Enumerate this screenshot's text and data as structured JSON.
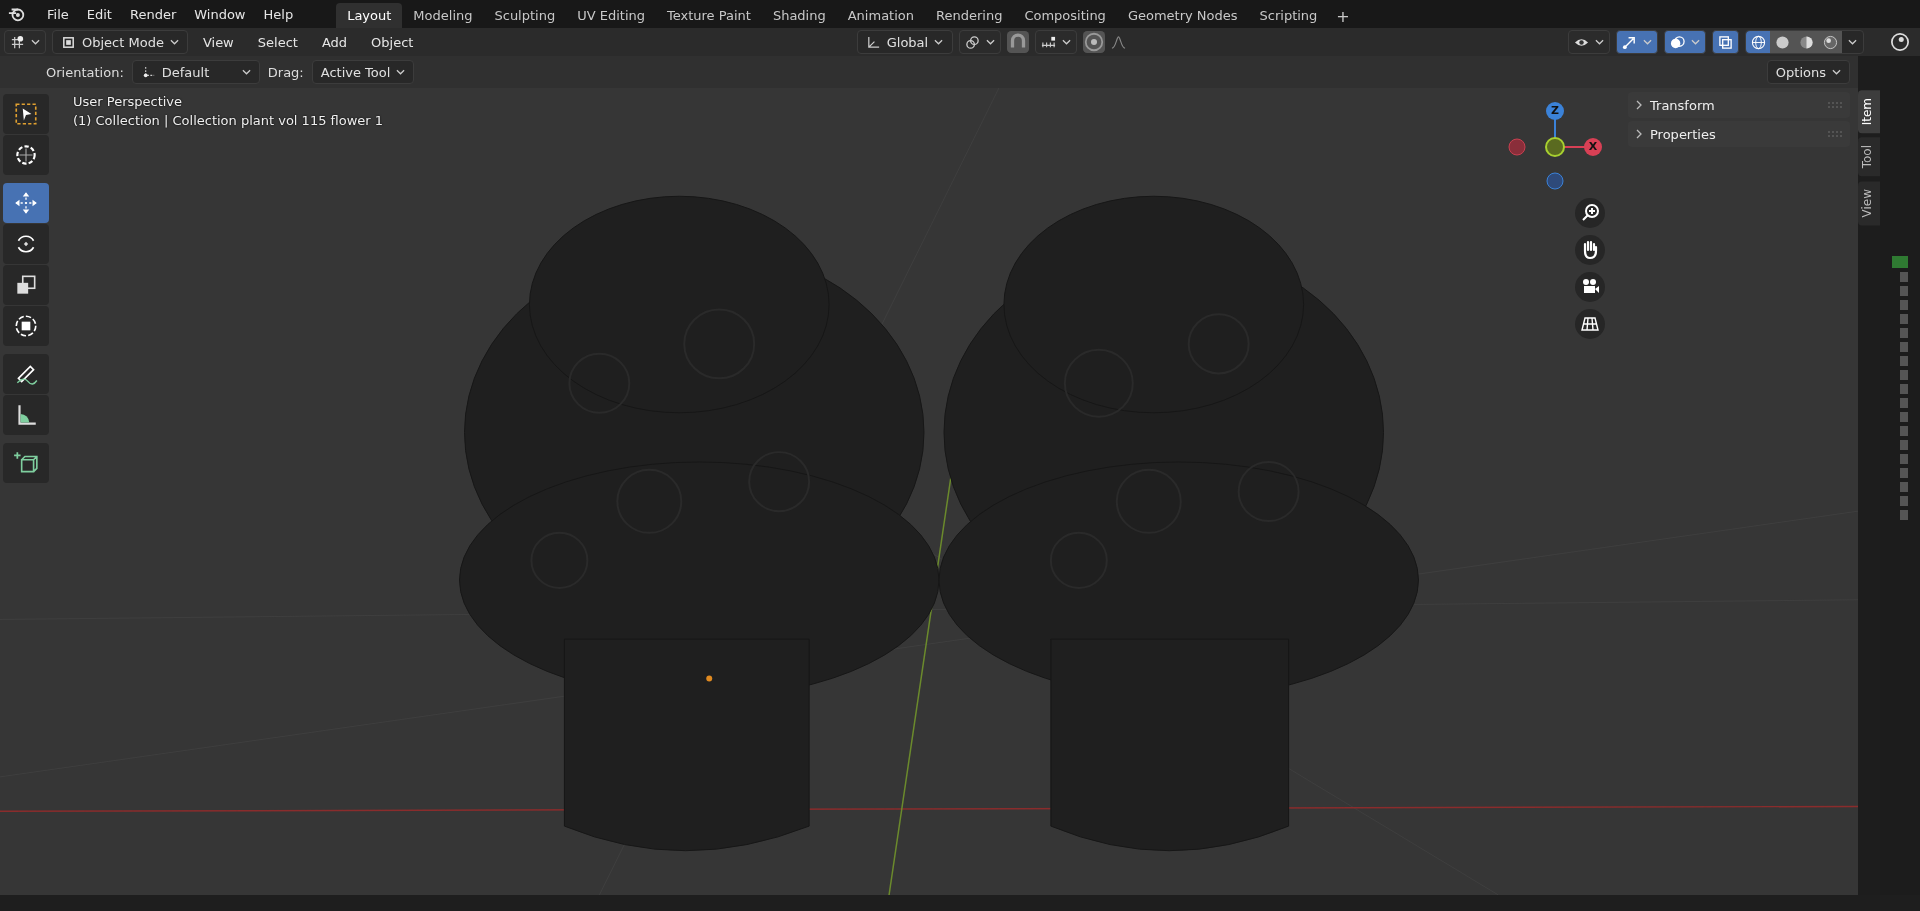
{
  "menubar": {
    "items": [
      "File",
      "Edit",
      "Render",
      "Window",
      "Help"
    ]
  },
  "workspaces": [
    {
      "label": "Layout",
      "selected": true
    },
    {
      "label": "Modeling",
      "selected": false
    },
    {
      "label": "Sculpting",
      "selected": false
    },
    {
      "label": "UV Editing",
      "selected": false
    },
    {
      "label": "Texture Paint",
      "selected": false
    },
    {
      "label": "Shading",
      "selected": false
    },
    {
      "label": "Animation",
      "selected": false
    },
    {
      "label": "Rendering",
      "selected": false
    },
    {
      "label": "Compositing",
      "selected": false
    },
    {
      "label": "Geometry Nodes",
      "selected": false
    },
    {
      "label": "Scripting",
      "selected": false
    }
  ],
  "add_workspace": "+",
  "header": {
    "mode": "Object Mode",
    "menus": [
      "View",
      "Select",
      "Add",
      "Object"
    ],
    "orientation": "Global",
    "toggles": [
      {
        "kind": "visibility",
        "on": false
      },
      {
        "kind": "gizmo",
        "on": true
      },
      {
        "kind": "overlay",
        "on": true
      },
      {
        "kind": "xray",
        "on": true
      }
    ],
    "shading": [
      {
        "kind": "wireframe",
        "selected": true
      },
      {
        "kind": "solid",
        "selected": false
      },
      {
        "kind": "material",
        "selected": false
      },
      {
        "kind": "rendered",
        "selected": false
      }
    ]
  },
  "tool_settings": {
    "orientation_label": "Orientation:",
    "orientation": "Default",
    "drag_label": "Drag:",
    "drag": "Active Tool",
    "options": "Options"
  },
  "toolbar": [
    [
      {
        "kind": "select",
        "selected": false
      },
      {
        "kind": "cursor",
        "selected": false
      }
    ],
    [
      {
        "kind": "move",
        "selected": true
      },
      {
        "kind": "rotate",
        "selected": false
      },
      {
        "kind": "scale",
        "selected": false
      },
      {
        "kind": "transform",
        "selected": false
      }
    ],
    [
      {
        "kind": "annotate",
        "selected": false
      },
      {
        "kind": "measure",
        "selected": false
      }
    ],
    [
      {
        "kind": "add-cube",
        "selected": false
      }
    ]
  ],
  "viewport": {
    "view_name": "User Perspective",
    "collection": "(1) Collection | Collection plant vol 115 flower 1"
  },
  "gizmo": {
    "z": "Z",
    "x": "X"
  },
  "sidebar": {
    "panels": [
      "Transform",
      "Properties"
    ],
    "tabs": [
      {
        "label": "Item",
        "selected": true
      },
      {
        "label": "Tool",
        "selected": false
      },
      {
        "label": "View",
        "selected": false
      }
    ]
  }
}
